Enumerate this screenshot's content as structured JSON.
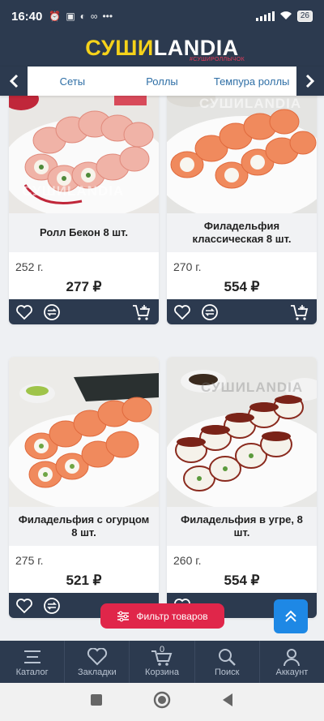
{
  "status_bar": {
    "time": "16:40",
    "battery": "26"
  },
  "header": {
    "logo_part1": "СУШИ",
    "logo_part2": "LANDIA",
    "logo_tagline": "#СУШИРОЛЛЫЧОК",
    "colors": {
      "background": "#2c3a4f",
      "logo_yellow": "#f5d21a",
      "logo_white": "#ffffff"
    }
  },
  "tabs": {
    "items": [
      {
        "label": "Сеты"
      },
      {
        "label": "Роллы"
      },
      {
        "label": "Темпура роллы"
      }
    ],
    "prev_icon": "chevron-left-icon",
    "next_icon": "chevron-right-icon"
  },
  "products": [
    {
      "name": "Ролл Бекон 8 шт.",
      "weight": "252 г.",
      "price": "277 ₽",
      "watermark": "СУШИLANDIA"
    },
    {
      "name": "Филадельфия классическая 8 шт.",
      "weight": "270 г.",
      "price": "554 ₽",
      "watermark": "СУШИLANDIA"
    },
    {
      "name": "Филадельфия с огурцом 8 шт.",
      "weight": "275 г.",
      "price": "521 ₽",
      "watermark": ""
    },
    {
      "name": "Филадельфия в угре, 8 шт.",
      "weight": "260 г.",
      "price": "554 ₽",
      "watermark": "СУШИLANDIA"
    }
  ],
  "filter_button": {
    "label": "Фильтр товаров"
  },
  "bottom_nav": {
    "items": [
      {
        "label": "Каталог",
        "icon": "menu-icon"
      },
      {
        "label": "Закладки",
        "icon": "heart-icon"
      },
      {
        "label": "Корзина",
        "icon": "cart-icon",
        "count": "0"
      },
      {
        "label": "Поиск",
        "icon": "search-icon"
      },
      {
        "label": "Аккаунт",
        "icon": "user-icon"
      }
    ]
  },
  "colors": {
    "accent_red": "#e0264a",
    "accent_blue": "#1e88e5",
    "tab_text": "#2f6fa6",
    "dark_panel": "#2c3a4f"
  }
}
